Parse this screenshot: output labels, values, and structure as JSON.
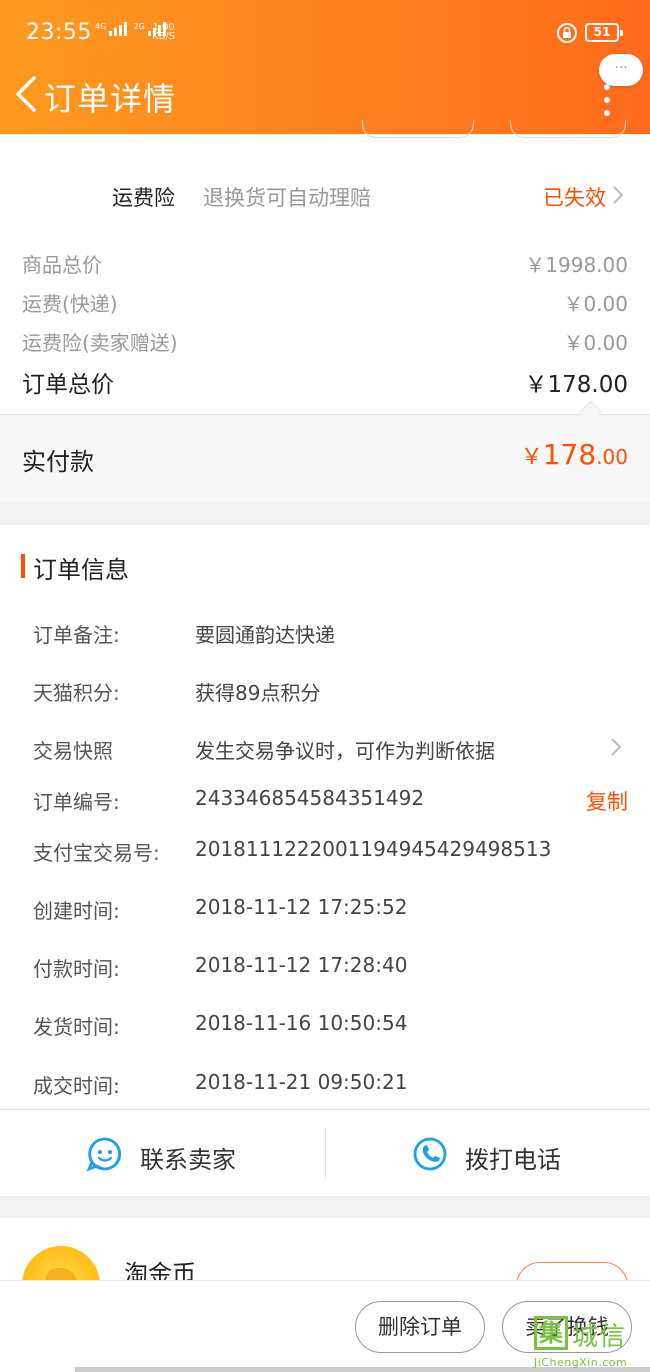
{
  "status_bar": {
    "time": "23:55",
    "signal_1": "4G",
    "signal_2": "2G",
    "net_speed_value": "1.00",
    "net_speed_unit": "KB/S",
    "battery": "51"
  },
  "header": {
    "title": "订单详情",
    "more_bubble": "···"
  },
  "insurance": {
    "label": "运费险",
    "description": "退换货可自动理赔",
    "status": "已失效"
  },
  "price_summary": [
    {
      "label": "商品总价",
      "value": "￥1998.00"
    },
    {
      "label": "运费(快递)",
      "value": "￥0.00"
    },
    {
      "label": "运费险(卖家赠送)",
      "value": "￥0.00"
    }
  ],
  "order_total": {
    "label": "订单总价",
    "value": "￥178.00"
  },
  "paid": {
    "label": "实付款",
    "currency": "￥",
    "integer": "178",
    "decimal": ".00"
  },
  "order_info": {
    "heading": "订单信息",
    "rows": [
      {
        "key": "订单备注:",
        "value": "要圆通韵达快递"
      },
      {
        "key": "天猫积分:",
        "value": "获得89点积分"
      },
      {
        "key": "交易快照",
        "value": "发生交易争议时，可作为判断依据"
      },
      {
        "key": "订单编号:",
        "value": "243346854584351492",
        "action": "复制"
      },
      {
        "key": "支付宝交易号:",
        "value": "2018111222001194945429498513"
      },
      {
        "key": "创建时间:",
        "value": "2018-11-12 17:25:52"
      },
      {
        "key": "付款时间:",
        "value": "2018-11-12 17:28:40"
      },
      {
        "key": "发货时间:",
        "value": "2018-11-16 10:50:54"
      },
      {
        "key": "成交时间:",
        "value": "2018-11-21 09:50:21"
      }
    ]
  },
  "contact": {
    "seller": "联系卖家",
    "phone": "拨打电话"
  },
  "coin": {
    "title": "淘金币"
  },
  "footer": {
    "delete": "删除订单",
    "sell": "卖了换钱"
  },
  "watermark": {
    "cn": "城信",
    "en": "JiChengXin.com",
    "glyph": "集"
  },
  "colors": {
    "accent": "#ff5000",
    "header_start": "#ff9a1f",
    "header_end": "#ff6a1c",
    "icon_blue": "#1ba1e6"
  }
}
